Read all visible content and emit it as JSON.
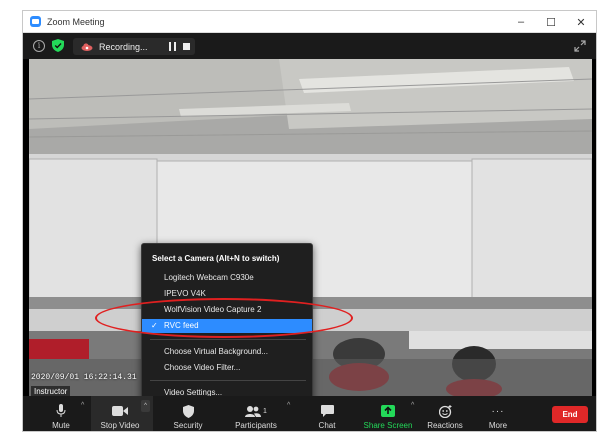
{
  "window": {
    "title": "Zoom Meeting",
    "minimize": "–",
    "maximize": "☐",
    "close": "✕"
  },
  "topbar": {
    "info_glyph": "i",
    "recording_label": "Recording..."
  },
  "video": {
    "timestamp": "2020/09/01 16:22:14.31",
    "participant_name": "Instructor"
  },
  "camera_menu": {
    "heading": "Select a Camera (Alt+N to switch)",
    "cameras": [
      "Logitech Webcam C930e",
      "IPEVO V4K",
      "WolfVision Video Capture 2",
      "RVC feed"
    ],
    "selected_camera": "RVC feed",
    "check_glyph": "✓",
    "options": [
      "Choose Virtual Background...",
      "Choose Video Filter..."
    ],
    "settings": "Video Settings..."
  },
  "toolbar": {
    "mute": "Mute",
    "stop_video": "Stop Video",
    "security": "Security",
    "participants": "Participants",
    "participants_count": "1",
    "chat": "Chat",
    "share_screen": "Share Screen",
    "reactions": "Reactions",
    "more": "More",
    "more_glyph": "···",
    "end": "End",
    "caret_glyph": "^"
  },
  "colors": {
    "accent_blue": "#2d8cff",
    "share_green": "#23d959",
    "end_red": "#e02828",
    "annotation_red": "#e02020"
  }
}
